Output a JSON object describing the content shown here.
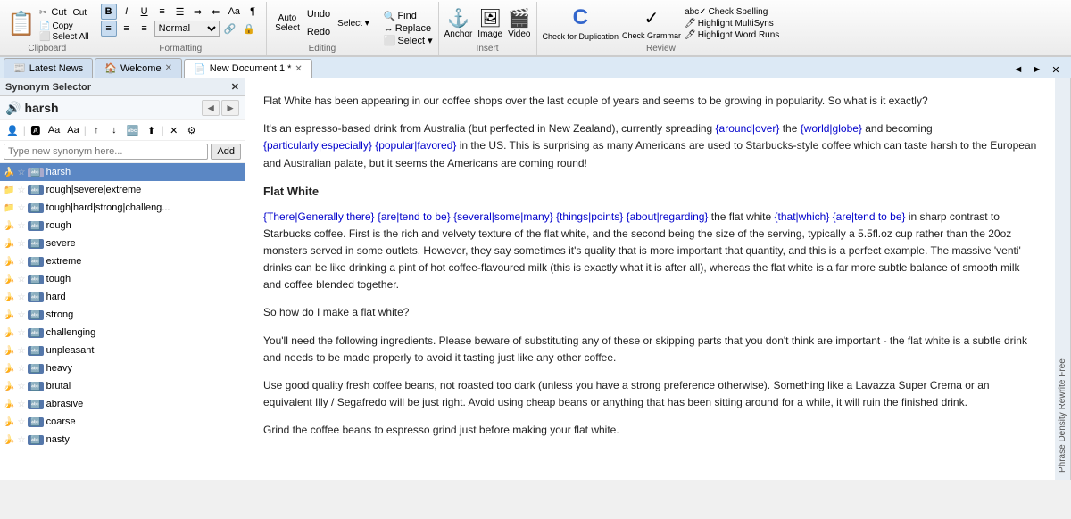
{
  "toolbar": {
    "clipboard": {
      "label": "Clipboard",
      "paste_label": "Paste",
      "cut_label": "Cut",
      "copy_label": "Copy",
      "select_all_label": "Select All"
    },
    "formatting": {
      "label": "Formatting",
      "bold": "B",
      "italic": "I",
      "underline": "U",
      "bullets_label": "Normal",
      "align_left": "≡",
      "align_center": "≡",
      "align_right": "≡"
    },
    "editing": {
      "label": "Editing",
      "auto_select": "Auto\nSelect",
      "undo": "Undo",
      "redo": "Redo",
      "select": "Select ▾"
    },
    "insert": {
      "label": "Insert",
      "anchor": "Anchor",
      "image": "Image",
      "video": "Video"
    },
    "review": {
      "label": "Review",
      "check_spelling": "Check Spelling",
      "check_duplication": "Check for\nDuplication",
      "check_grammar": "Check\nGrammar",
      "highlight_multi": "Highlight MultiSyns",
      "highlight_word": "Highlight Word Runs"
    }
  },
  "tabs": [
    {
      "id": "latest-news",
      "label": "Latest News",
      "icon": "📰",
      "closeable": false,
      "active": false
    },
    {
      "id": "welcome",
      "label": "Welcome",
      "icon": "🏠",
      "closeable": true,
      "active": false
    },
    {
      "id": "new-document",
      "label": "New Document 1 *",
      "icon": "📄",
      "closeable": true,
      "active": true
    }
  ],
  "synonym_panel": {
    "title": "Synonym Selector",
    "close_icon": "✕",
    "current_word": "harsh",
    "search_placeholder": "Type new synonym here...",
    "add_button": "Add",
    "nav_prev": "◄",
    "nav_next": "►",
    "items": [
      {
        "id": 1,
        "text": "harsh",
        "selected": true,
        "starred": false,
        "has_badge": true,
        "group": false
      },
      {
        "id": 2,
        "text": "rough|severe|extreme",
        "selected": false,
        "starred": false,
        "has_badge": false,
        "group": true
      },
      {
        "id": 3,
        "text": "tough|hard|strong|challeng...",
        "selected": false,
        "starred": false,
        "has_badge": false,
        "group": true
      },
      {
        "id": 4,
        "text": "rough",
        "selected": false,
        "starred": false,
        "has_badge": true,
        "group": false
      },
      {
        "id": 5,
        "text": "severe",
        "selected": false,
        "starred": false,
        "has_badge": true,
        "group": false
      },
      {
        "id": 6,
        "text": "extreme",
        "selected": false,
        "starred": false,
        "has_badge": true,
        "group": false
      },
      {
        "id": 7,
        "text": "tough",
        "selected": false,
        "starred": false,
        "has_badge": true,
        "group": false
      },
      {
        "id": 8,
        "text": "hard",
        "selected": false,
        "starred": false,
        "has_badge": true,
        "group": false
      },
      {
        "id": 9,
        "text": "strong",
        "selected": false,
        "starred": false,
        "has_badge": true,
        "group": false
      },
      {
        "id": 10,
        "text": "challenging",
        "selected": false,
        "starred": false,
        "has_badge": true,
        "group": false
      },
      {
        "id": 11,
        "text": "unpleasant",
        "selected": false,
        "starred": false,
        "has_badge": true,
        "group": false
      },
      {
        "id": 12,
        "text": "heavy",
        "selected": false,
        "starred": false,
        "has_badge": true,
        "group": false
      },
      {
        "id": 13,
        "text": "brutal",
        "selected": false,
        "starred": false,
        "has_badge": true,
        "group": false
      },
      {
        "id": 14,
        "text": "abrasive",
        "selected": false,
        "starred": false,
        "has_badge": true,
        "group": false
      },
      {
        "id": 15,
        "text": "coarse",
        "selected": false,
        "starred": false,
        "has_badge": true,
        "group": false
      },
      {
        "id": 16,
        "text": "nasty",
        "selected": false,
        "starred": false,
        "has_badge": true,
        "group": false
      }
    ]
  },
  "right_panel_label": "Phrase Density  Rewrite  Free",
  "document": {
    "paragraphs": [
      {
        "type": "text",
        "content": "Flat White has been appearing in our coffee shops over the last couple of years and seems to be growing in popularity. So what is it exactly?"
      },
      {
        "type": "text_with_alts",
        "content": "It's an espresso-based drink from Australia (but perfected in New Zealand), currently spreading {around|over} the {world|globe} and becoming {particularly|especially} {popular|favored} in the US. This is surprising as many Americans are used to Starbucks-style coffee which can taste harsh to the European and Australian palate, but it seems the Americans are coming round!"
      },
      {
        "type": "heading",
        "content": "Flat White"
      },
      {
        "type": "text_with_alts",
        "content": "{There|Generally there} {are|tend to be} {several|some|many} {things|points} {about|regarding} the flat white {that|which} {are|tend to be} in sharp contrast to Starbucks coffee. First is the rich and velvety texture of the flat white, and the second being the size of the serving, typically a 5.5fl.oz cup rather than the 20oz monsters served in some outlets. However, they say sometimes it's quality that is more important that quantity, and this is a perfect example. The massive 'venti' drinks can be like drinking a pint of hot coffee-flavoured milk (this is exactly what it is after all), whereas the flat white is a far more subtle balance of smooth milk and coffee blended together."
      },
      {
        "type": "text",
        "content": "So how do I make a flat white?"
      },
      {
        "type": "text",
        "content": "You'll need the following ingredients. Please beware of substituting any of these or skipping parts that you don't think are important - the flat white is a subtle drink and needs to be made properly to avoid it tasting just like any other coffee."
      },
      {
        "type": "text",
        "content": "Use good quality fresh coffee beans, not roasted too dark (unless you have a strong preference otherwise). Something like a Lavazza Super Crema or an equivalent Illy / Segafredo will be just right. Avoid using cheap beans or anything that has been sitting around for a while, it will ruin the finished drink."
      },
      {
        "type": "text",
        "content": "Grind the coffee beans to espresso grind just before making your flat white."
      }
    ]
  }
}
